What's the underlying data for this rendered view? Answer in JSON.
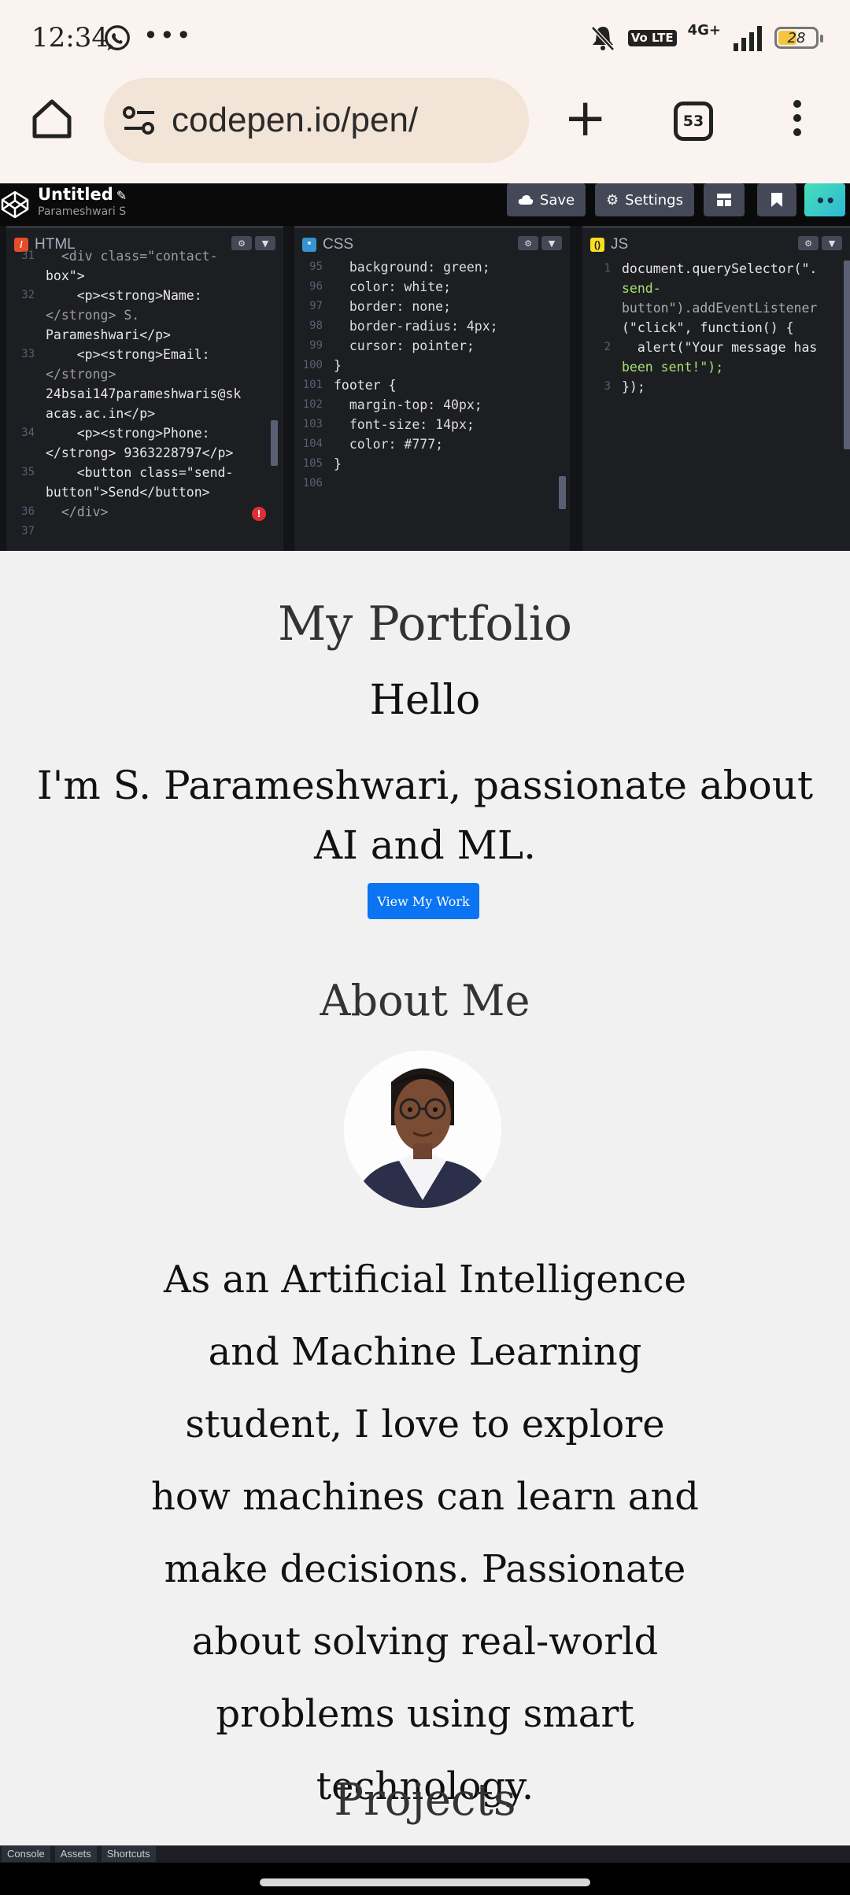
{
  "status_bar": {
    "time": "12:34",
    "dots": "•••",
    "volte": "Vo LTE",
    "network": "4G+",
    "battery": "28",
    "battery_level_pct": 28
  },
  "browser": {
    "url": "codepen.io/pen/",
    "tab_count": "53"
  },
  "codepen": {
    "pen_title": "Untitled",
    "author": "Parameshwari S",
    "save_label": "Save",
    "settings_label": "Settings",
    "panes": {
      "html": "HTML",
      "css": "CSS",
      "js": "JS"
    },
    "bottom_tabs": [
      "Console",
      "Assets",
      "Shortcuts"
    ]
  },
  "html_code": {
    "lines": [
      {
        "ln": "31",
        "text": "  <div class=\"contact-"
      },
      {
        "ln": "",
        "text": "box\">"
      },
      {
        "ln": "32",
        "text": "    <p><strong>Name:"
      },
      {
        "ln": "",
        "text": "</strong> S."
      },
      {
        "ln": "",
        "text": "Parameshwari</p>"
      },
      {
        "ln": "33",
        "text": "    <p><strong>Email:"
      },
      {
        "ln": "",
        "text": "</strong>"
      },
      {
        "ln": "",
        "text": "24bsai147parameshwaris@sk"
      },
      {
        "ln": "",
        "text": "acas.ac.in</p>"
      },
      {
        "ln": "34",
        "text": "    <p><strong>Phone:"
      },
      {
        "ln": "",
        "text": "</strong> 9363228797</p>"
      },
      {
        "ln": "35",
        "text": "    <button class=\"send-"
      },
      {
        "ln": "",
        "text": "button\">Send</button>"
      },
      {
        "ln": "36",
        "text": "  </div>"
      },
      {
        "ln": "37",
        "text": ""
      }
    ]
  },
  "css_code": {
    "lines": [
      {
        "ln": "95",
        "text": "  background: green;"
      },
      {
        "ln": "96",
        "text": "  color: white;"
      },
      {
        "ln": "97",
        "text": "  border: none;"
      },
      {
        "ln": "98",
        "text": "  border-radius: 4px;"
      },
      {
        "ln": "99",
        "text": "  cursor: pointer;"
      },
      {
        "ln": "100",
        "text": "}"
      },
      {
        "ln": "101",
        "text": ""
      },
      {
        "ln": "102",
        "text": "footer {"
      },
      {
        "ln": "103",
        "text": "  margin-top: 40px;"
      },
      {
        "ln": "104",
        "text": "  font-size: 14px;"
      },
      {
        "ln": "105",
        "text": "  color: #777;"
      },
      {
        "ln": "106",
        "text": "}"
      }
    ]
  },
  "js_code": {
    "lines": [
      {
        "ln": "1",
        "text": "document.querySelector(\"."
      },
      {
        "ln": "",
        "text": "send-"
      },
      {
        "ln": "",
        "text": "button\").addEventListener"
      },
      {
        "ln": "",
        "text": "(\"click\", function() {"
      },
      {
        "ln": "2",
        "text": "  alert(\"Your message has"
      },
      {
        "ln": "",
        "text": "been sent!\");"
      },
      {
        "ln": "3",
        "text": "});"
      }
    ]
  },
  "preview": {
    "title": "My Portfolio",
    "hello": "Hello",
    "intro": "I'm S. Parameshwari, passionate about AI and ML.",
    "button": "View My Work",
    "about_heading": "About Me",
    "bio": "As an Artificial Intelligence and Machine Learning student, I love to explore how machines can learn and make decisions. Passionate about solving real-world problems using smart technology.",
    "projects_heading": "Projects"
  }
}
